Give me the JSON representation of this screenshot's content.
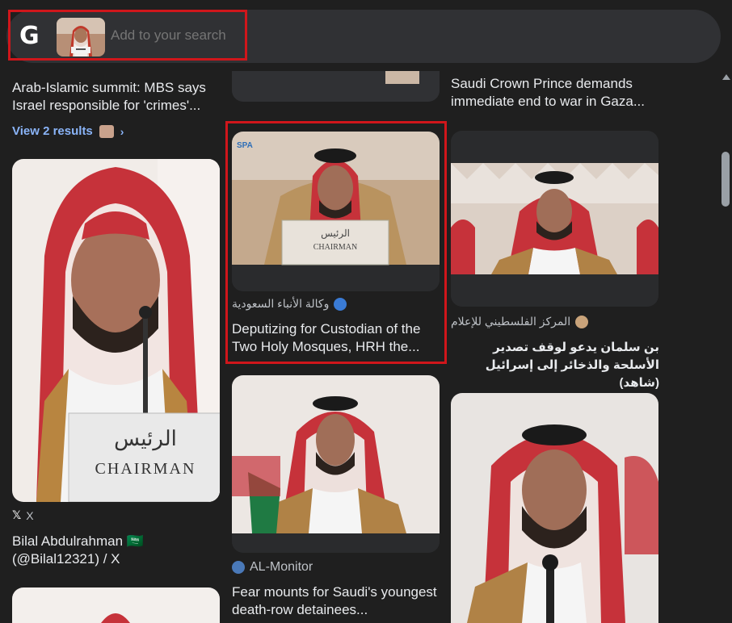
{
  "search": {
    "placeholder": "Add to your search",
    "logo": "G"
  },
  "col1": {
    "top_title": "Arab-Islamic summit: MBS says Israel responsible for 'crimes'...",
    "view_results": "View 2 results",
    "card1": {
      "source": "X",
      "title": "Bilal Abdulrahman 🇸🇦 (@Bilal12321) / X",
      "image_text_ar": "الرئيس",
      "image_text_en": "CHAIRMAN"
    }
  },
  "col2": {
    "card1": {
      "source": "وكالة الأنباء السعودية",
      "title": "Deputizing for Custodian of the Two Holy Mosques, HRH the...",
      "watermark": "SPA",
      "image_text_ar": "الرئيس",
      "image_text_en": "CHAIRMAN"
    },
    "card2": {
      "source": "AL-Monitor",
      "title": "Fear mounts for Saudi's youngest death-row detainees..."
    }
  },
  "col3": {
    "top_title": "Saudi Crown Prince demands immediate end to war in Gaza...",
    "card1": {
      "source": "المركز الفلسطيني للإعلام",
      "title": "بن سلمان يدعو لوقف تصدير الأسلحة والذخائر إلى إسرائيل (شاهد)"
    }
  },
  "colors": {
    "background": "#1f1f1f",
    "highlight": "#d0161b",
    "link": "#8ab4f8"
  }
}
